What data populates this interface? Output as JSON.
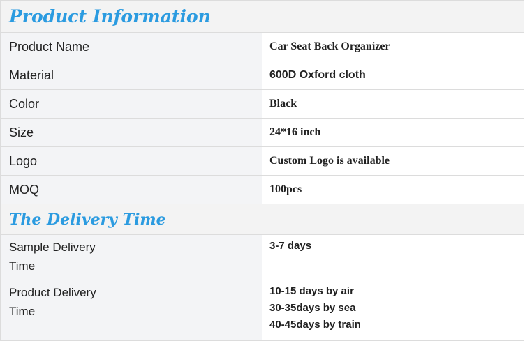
{
  "product_section": {
    "title": "Product Information",
    "rows": [
      {
        "label": "Product Name",
        "value": "Car Seat Back Organizer",
        "style": "serif"
      },
      {
        "label": "Material",
        "value": "600D Oxford cloth",
        "style": "sans"
      },
      {
        "label": "Color",
        "value": "Black",
        "style": "serif"
      },
      {
        "label": "Size",
        "value": "24*16 inch",
        "style": "serif"
      },
      {
        "label": "Logo",
        "value": "Custom Logo is available",
        "style": "serif"
      },
      {
        "label": "MOQ",
        "value": "100pcs",
        "style": "serif"
      }
    ]
  },
  "delivery_section": {
    "title": "The Delivery Time",
    "sample": {
      "label_lines": [
        "Sample Delivery",
        "Time"
      ],
      "value_lines": [
        "3-7 days"
      ]
    },
    "product": {
      "label_lines": [
        "Product Delivery",
        "Time"
      ],
      "value_lines": [
        "10-15 days by air",
        "30-35days by sea",
        "40-45days by train"
      ]
    }
  },
  "colors": {
    "heading": "#2b9be0",
    "label_background": "#f3f4f6",
    "border": "#dcdcdc",
    "text": "#222222"
  }
}
